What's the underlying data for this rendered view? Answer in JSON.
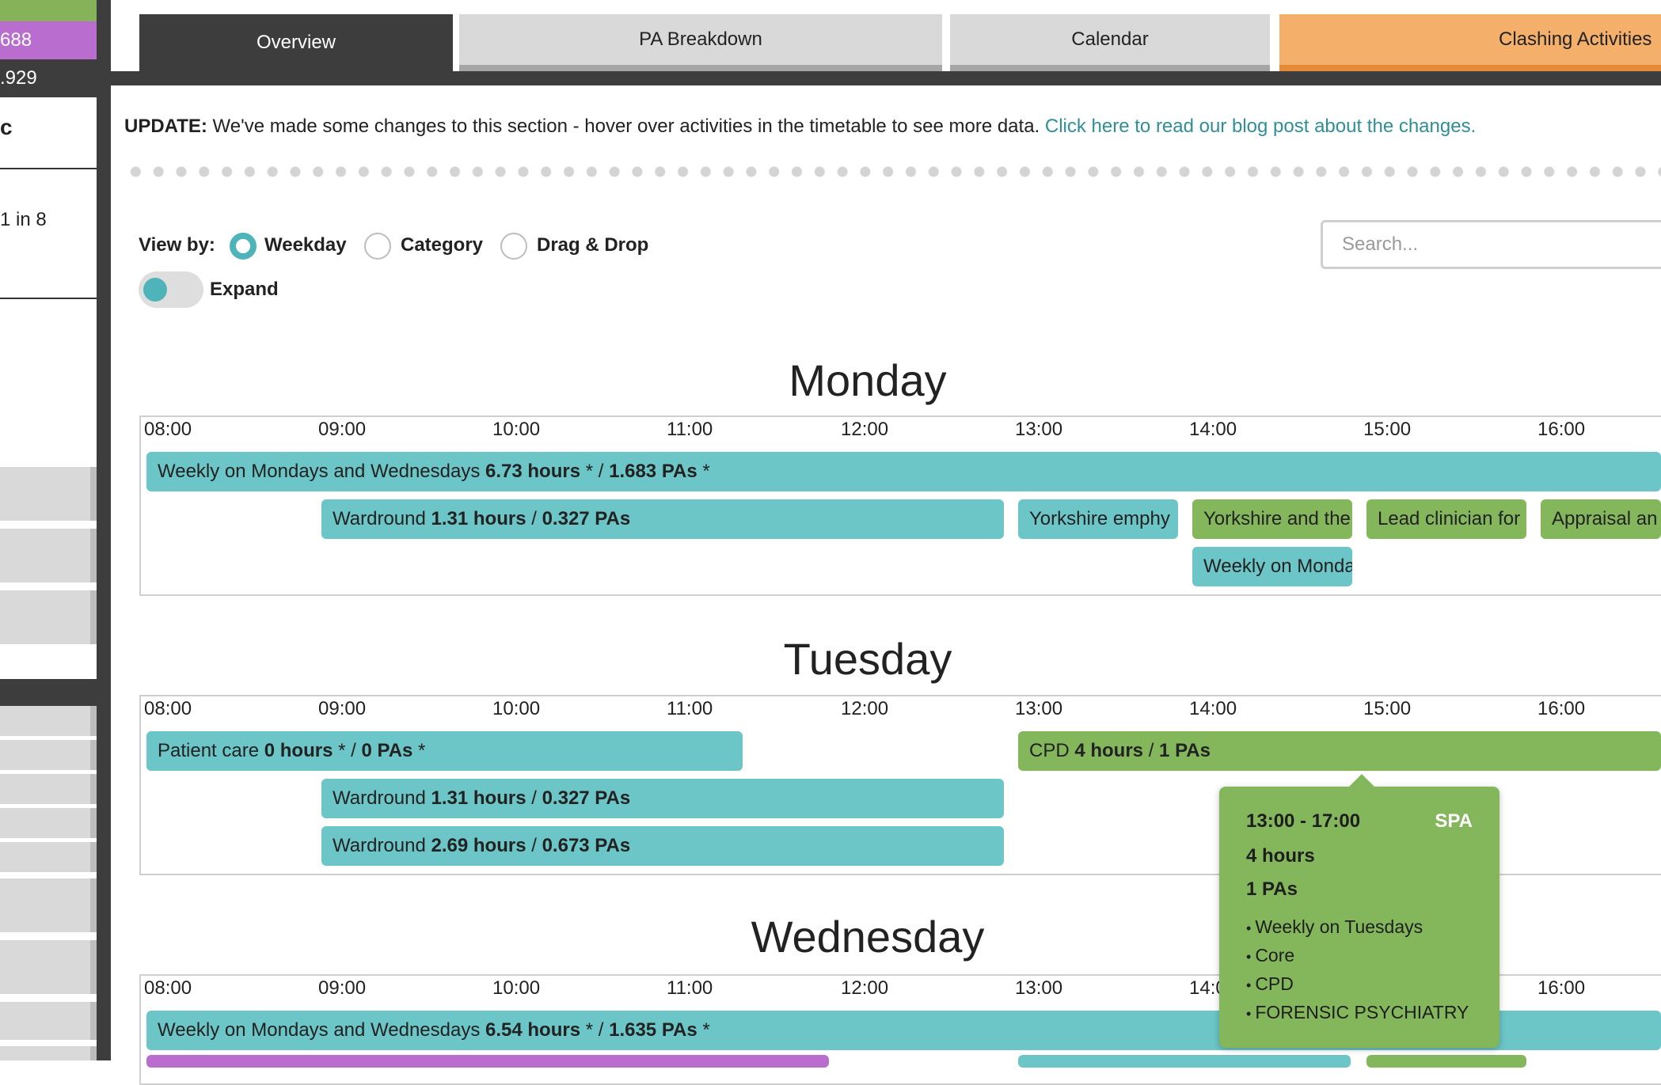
{
  "sidebar": {
    "purple_value": "688",
    "dark_value": ".929",
    "heading_char": "c",
    "frequency": "1 in 8"
  },
  "tabs": [
    {
      "label": "Overview"
    },
    {
      "label": "PA Breakdown"
    },
    {
      "label": "Calendar"
    },
    {
      "label": "Clashing Activities"
    }
  ],
  "update": {
    "prefix": "UPDATE:",
    "message": " We've made some changes to this section - hover over activities in the timetable to see more data. ",
    "link": "Click here to read our blog post about the changes."
  },
  "controls": {
    "view_by_label": "View by:",
    "options": [
      "Weekday",
      "Category",
      "Drag & Drop"
    ],
    "selected": "Weekday",
    "expand_label": "Expand",
    "search_placeholder": "Search..."
  },
  "time_ticks": [
    "08:00",
    "09:00",
    "10:00",
    "11:00",
    "12:00",
    "13:00",
    "14:00",
    "15:00",
    "16:00"
  ],
  "days": [
    {
      "name": "Monday",
      "rows": [
        [
          {
            "name": "Weekly on Mondays and Wednesdays",
            "hours": "6.73 hours",
            "hours_star": " * ",
            "pas": "1.683 PAs",
            "pas_star": " *",
            "color": "teal"
          }
        ],
        [
          {
            "name": "Wardround",
            "hours": "1.31 hours",
            "pas": "0.327 PAs",
            "color": "teal"
          },
          {
            "name": "Yorkshire emphy",
            "color": "teal"
          },
          {
            "name": "Yorkshire and the",
            "color": "green"
          },
          {
            "name": "Lead clinician for",
            "color": "green"
          },
          {
            "name": "Appraisal an",
            "color": "green"
          }
        ],
        [
          {
            "name": "Weekly on Monda",
            "color": "teal"
          }
        ]
      ]
    },
    {
      "name": "Tuesday",
      "rows": [
        [
          {
            "name": "Patient care",
            "hours": "0 hours",
            "hours_star": " * ",
            "pas": "0 PAs",
            "pas_star": " *",
            "color": "teal"
          },
          {
            "name": "CPD",
            "hours": "4 hours",
            "pas": "1 PAs",
            "color": "green"
          }
        ],
        [
          {
            "name": "Wardround",
            "hours": "1.31 hours",
            "pas": "0.327 PAs",
            "color": "teal"
          }
        ],
        [
          {
            "name": "Wardround",
            "hours": "2.69 hours",
            "pas": "0.673 PAs",
            "color": "teal"
          }
        ]
      ]
    },
    {
      "name": "Wednesday",
      "rows": [
        [
          {
            "name": "Weekly on Mondays and Wednesdays",
            "hours": "6.54 hours",
            "hours_star": " * ",
            "pas": "1.635 PAs",
            "pas_star": " *",
            "color": "teal"
          }
        ]
      ]
    }
  ],
  "tooltip": {
    "time": "13:00 - 17:00",
    "type": "SPA",
    "hours": "4 hours",
    "pas": "1 PAs",
    "details": [
      "Weekly on Tuesdays",
      "Core",
      "CPD",
      "FORENSIC PSYCHIATRY"
    ]
  },
  "colors": {
    "teal": "#6cc5c6",
    "green": "#84b75b",
    "purple": "#b96dcf",
    "orange_tab": "#f4b06b",
    "dark": "#3d3d3d",
    "link": "#2f8f96"
  }
}
